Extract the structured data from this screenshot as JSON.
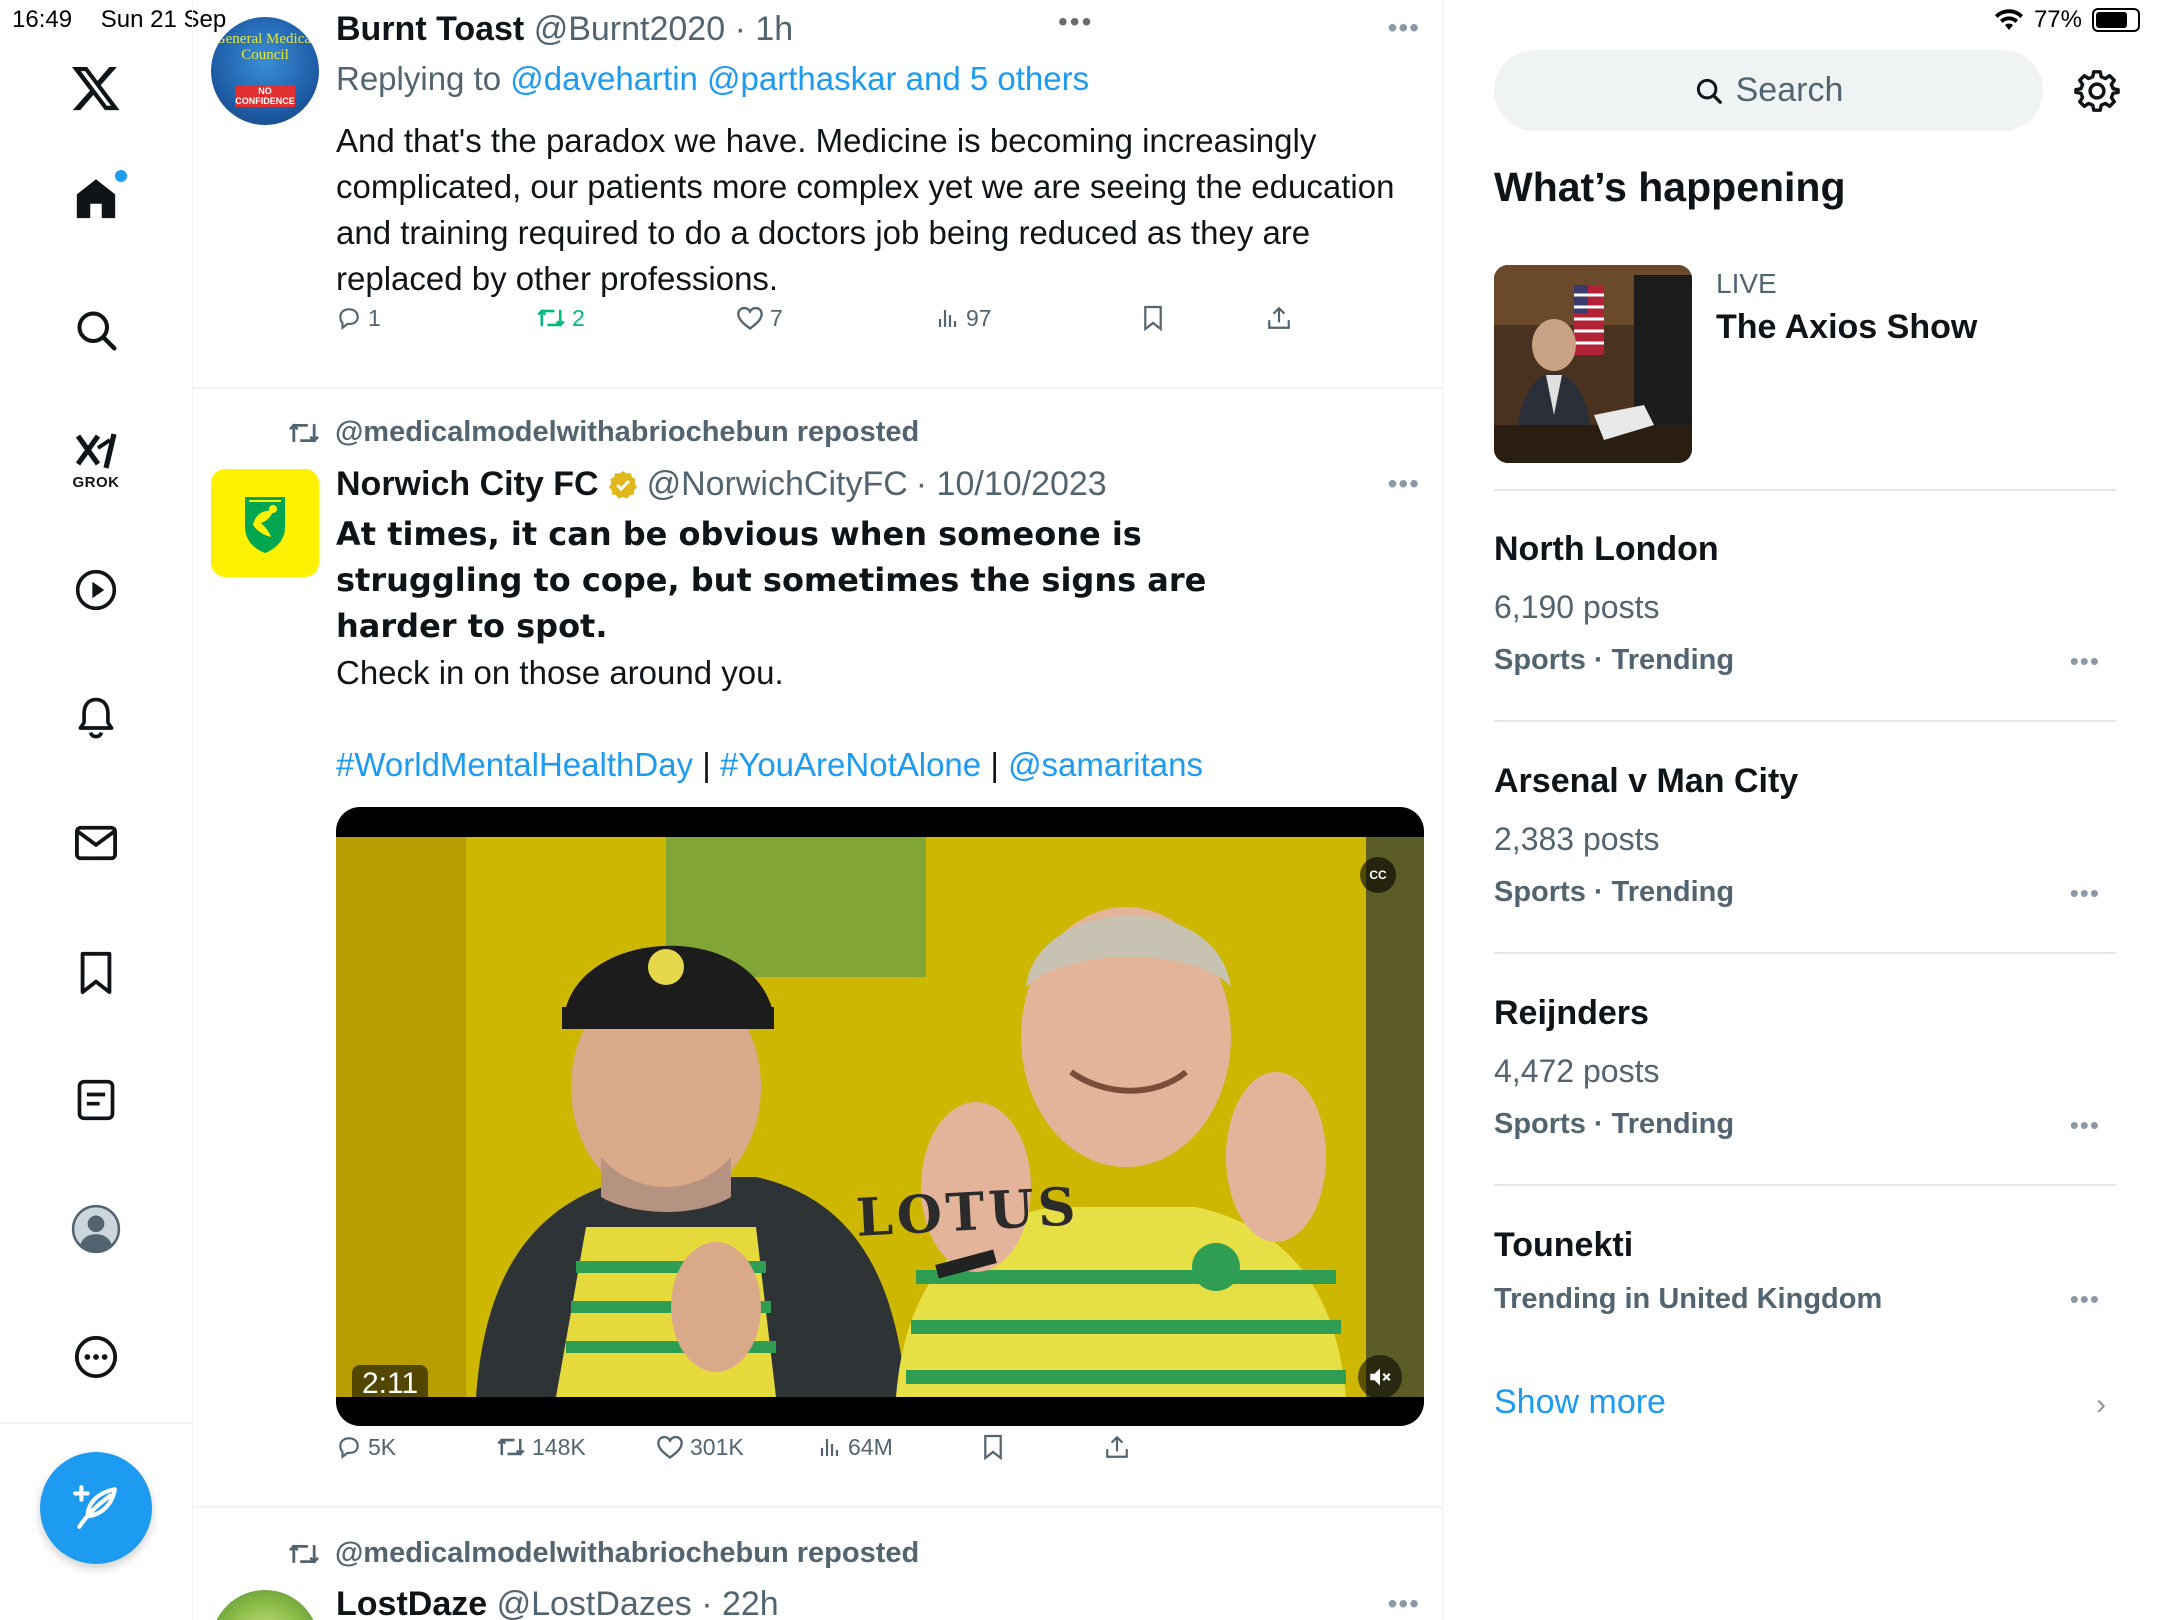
{
  "status_bar": {
    "time": "16:49",
    "date": "Sun 21 Sep",
    "battery": "77%",
    "battery_level": 0.77
  },
  "nav": {
    "grok_label": "GROK",
    "items": [
      "x-logo",
      "home-icon",
      "search-icon",
      "grok-icon",
      "video-icon",
      "notifications-icon",
      "messages-icon",
      "bookmarks-icon",
      "lists-icon",
      "profile-icon",
      "more-icon"
    ]
  },
  "tweet1": {
    "name": "Burnt Toast",
    "handle": "@Burnt2020",
    "time": "· 1h",
    "replying_prefix": "Replying to",
    "replying_to": "@davehartin @parthaskar and 5 others",
    "avatar_text": "General Medical Council",
    "avatar_badge": "NO CONFIDENCE",
    "text": "And that's the paradox we have. Medicine is becoming increasingly complicated, our patients more complex yet we are seeing the education and training required to do a doctors job being reduced as they are replaced by other professions.",
    "replies": "1",
    "reposts": "2",
    "likes": "7",
    "views": "97"
  },
  "tweet2": {
    "repost_by": "@medicalmodelwithabriochebun reposted",
    "name": "Norwich City FC",
    "handle": "@NorwichCityFC",
    "time": "· 10/10/2023",
    "text_bold": "At times, it can be obvious when someone is struggling to cope, but sometimes the signs are harder to spot.",
    "text_plain": "Check in on those around you.",
    "hashtag1": "#WorldMentalHealthDay",
    "sep1": "|",
    "hashtag2": "#YouAreNotAlone",
    "sep2": "|",
    "mention": "@samaritans",
    "video_duration": "2:11",
    "cc_label": "CC",
    "shirt_text": "LOTUS",
    "replies": "5K",
    "reposts": "148K",
    "likes": "301K",
    "views": "64M"
  },
  "tweet3": {
    "repost_by": "@medicalmodelwithabriochebun reposted",
    "name": "LostDaze",
    "handle": "@LostDazes",
    "time": "· 22h"
  },
  "sidebar": {
    "search_placeholder": "Search",
    "whats_happening": "What’s happening",
    "live_label": "LIVE",
    "live_title": "The Axios Show",
    "trends": [
      {
        "name": "North London",
        "posts": "6,190 posts",
        "meta": "Sports · Trending"
      },
      {
        "name": "Arsenal v Man City",
        "posts": "2,383 posts",
        "meta": "Sports · Trending"
      },
      {
        "name": "Reijnders",
        "posts": "4,472 posts",
        "meta": "Sports · Trending"
      },
      {
        "name": "Tounekti",
        "meta": "Trending in United Kingdom"
      }
    ],
    "show_more": "Show more"
  },
  "colors": {
    "accent": "#1d9bf0",
    "muted": "#536471",
    "repost_green": "#00ba7c",
    "norwich_yellow": "#fff200",
    "norwich_green": "#00a650"
  }
}
